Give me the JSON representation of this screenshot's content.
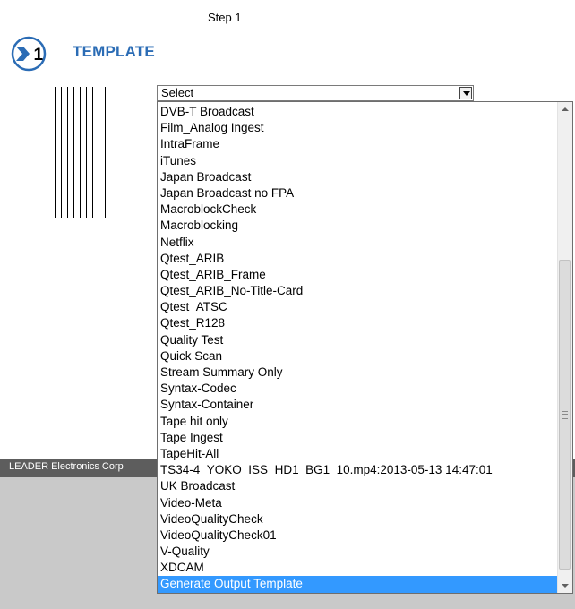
{
  "header": {
    "step_label": "Step 1",
    "badge_number": "1",
    "title": "TEMPLATE"
  },
  "select": {
    "current_value": "Select"
  },
  "dropdown": {
    "options": [
      "DVB-T Broadcast",
      "Film_Analog Ingest",
      "IntraFrame",
      "iTunes",
      "Japan Broadcast",
      "Japan Broadcast no FPA",
      "MacroblockCheck",
      "Macroblocking",
      "Netflix",
      "Qtest_ARIB",
      "Qtest_ARIB_Frame",
      "Qtest_ARIB_No-Title-Card",
      "Qtest_ATSC",
      "Qtest_R128",
      "Quality Test",
      "Quick Scan",
      "Stream Summary Only",
      "Syntax-Codec",
      "Syntax-Container",
      "Tape hit only",
      "Tape Ingest",
      "TapeHit-All",
      "TS34-4_YOKO_ISS_HD1_BG1_10.mp4:2013-05-13 14:47:01",
      "UK Broadcast",
      "Video-Meta",
      "VideoQualityCheck",
      "VideoQualityCheck01",
      "V-Quality",
      "XDCAM",
      "Generate Output Template"
    ],
    "highlighted_option": "Generate Output Template"
  },
  "footer": {
    "company_text": "LEADER Electronics Corp"
  },
  "colors": {
    "title_blue": "#2b6cb5",
    "highlight": "#3399ff",
    "footer_bar": "#5d5d5d",
    "footer_area": "#c9c9c9"
  },
  "icons": {
    "badge": "step-number-chevron-icon",
    "select_arrow": "chevron-down-icon",
    "scroll_up": "scroll-up-arrow-icon",
    "scroll_down": "scroll-down-arrow-icon"
  }
}
